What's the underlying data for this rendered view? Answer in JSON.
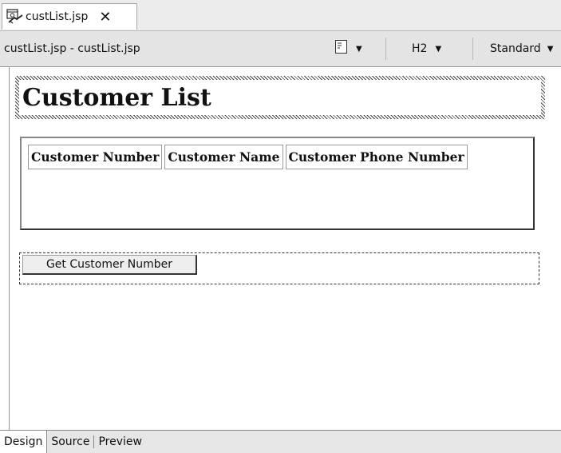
{
  "tab": {
    "title": "custList.jsp",
    "close": "✕",
    "icon": "jsp-file-icon"
  },
  "toolbar": {
    "file_label": "custList.jsp - custList.jsp",
    "paragraph_icon": "paragraph-format-icon",
    "style_select": "H2",
    "font_select": "Standard",
    "caret": "▼"
  },
  "page": {
    "heading": "Customer List",
    "table": {
      "headers": [
        "Customer Number",
        "Customer Name",
        "Customer Phone Number"
      ]
    },
    "button_label": "Get Customer Number"
  },
  "bottom_tabs": [
    "Design",
    "Source",
    "Preview"
  ],
  "colors": {
    "tab_bar": "#ececec",
    "toolbar": "#e4e4e4",
    "canvas": "#ffffff"
  }
}
